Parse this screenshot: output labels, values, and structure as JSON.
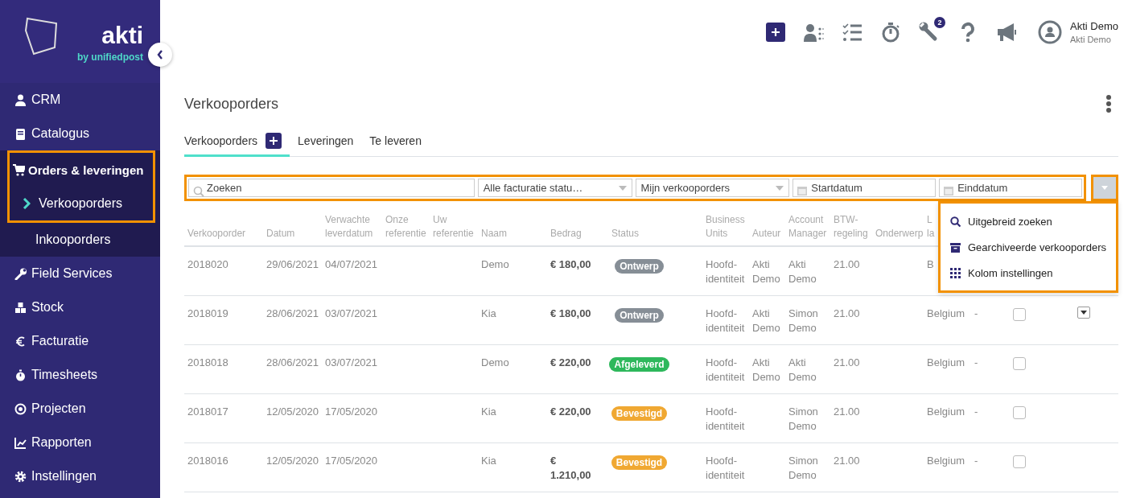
{
  "sidebar": {
    "logo": {
      "wordmark": "akti",
      "tagline": "by unifiedpost"
    },
    "items": [
      {
        "label": "CRM",
        "selected": false
      },
      {
        "label": "Catalogus",
        "selected": false
      },
      {
        "label": "Orders & leveringen",
        "selected": true,
        "highlighted": true,
        "expanded": true,
        "children": [
          {
            "label": "Verkooporders",
            "selected": true,
            "highlighted": true
          },
          {
            "label": "Inkooporders",
            "selected": false
          }
        ]
      },
      {
        "label": "Field Services",
        "selected": false
      },
      {
        "label": "Stock",
        "selected": false
      },
      {
        "label": "Facturatie",
        "selected": false
      },
      {
        "label": "Timesheets",
        "selected": false
      },
      {
        "label": "Projecten",
        "selected": false
      },
      {
        "label": "Rapporten",
        "selected": false
      },
      {
        "label": "Instellingen",
        "selected": false
      }
    ]
  },
  "topbar": {
    "tools_badge": "2",
    "user": {
      "name": "Akti Demo",
      "subtitle": "Akti Demo"
    }
  },
  "page": {
    "title": "Verkooporders",
    "tabs": [
      {
        "label": "Verkooporders",
        "selected": true,
        "add_button": true
      },
      {
        "label": "Leveringen",
        "selected": false
      },
      {
        "label": "Te leveren",
        "selected": false
      }
    ],
    "filters": {
      "highlighted": true,
      "search": {
        "placeholder": "Zoeken"
      },
      "selects": [
        {
          "value": "Alle facturatie statu…"
        },
        {
          "value": "Mijn verkooporders"
        }
      ],
      "dates": [
        {
          "placeholder": "Startdatum"
        },
        {
          "placeholder": "Einddatum"
        }
      ],
      "toggle": {
        "highlighted": true,
        "expanded": true
      }
    },
    "menu": {
      "highlighted": true,
      "items": [
        {
          "label": "Uitgebreid zoeken"
        },
        {
          "label": "Gearchiveerde verkooporders"
        },
        {
          "label": "Kolom instellingen"
        }
      ]
    },
    "table": {
      "columns": [
        "Verkooporder",
        "Datum",
        "Verwachte leverdatum",
        "Onze referentie",
        "Uw referentie",
        "Naam",
        "Bedrag",
        "Status",
        "Business Units",
        "Auteur",
        "Account Manager",
        "BTW-regeling",
        "Onderwerp",
        "L la"
      ],
      "rows": [
        {
          "order": "2018020",
          "date": "29/06/2021",
          "delivery": "04/07/2021",
          "name": "Demo",
          "amount": "€ 180,00",
          "status": {
            "label": "Ontwerp",
            "color": "#868e96"
          },
          "business_unit": "Hoofd-identiteit",
          "author": "Akti Demo",
          "account_manager": "Akti Demo",
          "vat": "21.00",
          "country": "B"
        },
        {
          "order": "2018019",
          "date": "28/06/2021",
          "delivery": "03/07/2021",
          "name": "Kia",
          "amount": "€ 180,00",
          "status": {
            "label": "Ontwerp",
            "color": "#868e96"
          },
          "business_unit": "Hoofd-identiteit",
          "author": "Akti Demo",
          "account_manager": "Simon Demo",
          "vat": "21.00",
          "country": "Belgium",
          "column_15": "-",
          "checked": false,
          "row_menu": true
        },
        {
          "order": "2018018",
          "date": "28/06/2021",
          "delivery": "03/07/2021",
          "name": "Demo",
          "amount": "€ 220,00",
          "status": {
            "label": "Afgeleverd",
            "color": "#2eb85c"
          },
          "business_unit": "Hoofd-identiteit",
          "author": "Akti Demo",
          "account_manager": "Akti Demo",
          "vat": "21.00",
          "country": "Belgium",
          "column_15": "-",
          "checked": false
        },
        {
          "order": "2018017",
          "date": "12/05/2020",
          "delivery": "17/05/2020",
          "name": "Kia",
          "amount": "€ 220,00",
          "status": {
            "label": "Bevestigd",
            "color": "#f0a832"
          },
          "business_unit": "Hoofd-identiteit",
          "account_manager": "Simon Demo",
          "vat": "21.00",
          "country": "Belgium",
          "column_15": "-",
          "checked": false
        },
        {
          "order": "2018016",
          "date": "12/05/2020",
          "delivery": "17/05/2020",
          "name": "Kia",
          "amount": "€ 1.210,00",
          "status": {
            "label": "Bevestigd",
            "color": "#f0a832"
          },
          "business_unit": "Hoofd-identiteit",
          "account_manager": "Simon Demo",
          "vat": "21.00",
          "country": "Belgium",
          "column_15": "-",
          "checked": false
        }
      ]
    }
  }
}
